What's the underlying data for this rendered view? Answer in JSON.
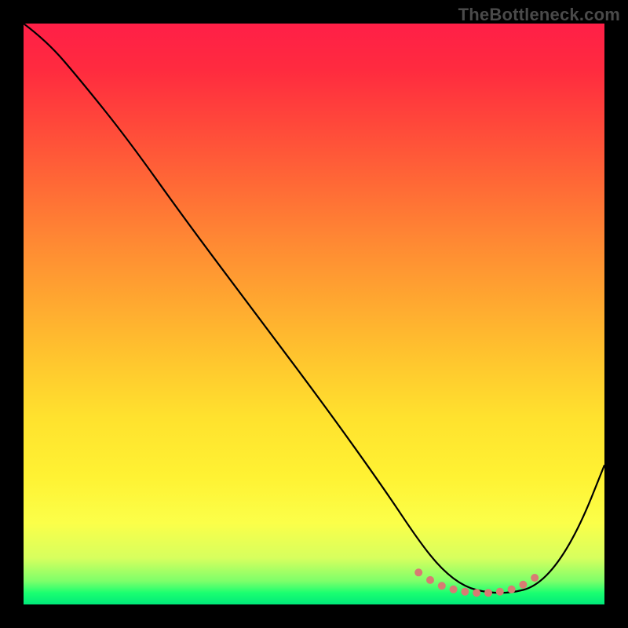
{
  "watermark": "TheBottleneck.com",
  "chart_data": {
    "type": "line",
    "title": "",
    "xlabel": "",
    "ylabel": "",
    "xlim": [
      0,
      100
    ],
    "ylim": [
      0,
      100
    ],
    "grid": false,
    "legend": false,
    "series": [
      {
        "name": "curve",
        "x": [
          0,
          4,
          10,
          18,
          28,
          40,
          52,
          62,
          68,
          72,
          76,
          80,
          84,
          88,
          92,
          96,
          100
        ],
        "y": [
          100,
          97,
          90,
          80,
          66,
          50,
          34,
          20,
          11,
          6,
          3,
          2,
          2,
          3,
          7,
          14,
          24
        ]
      }
    ],
    "markers": {
      "name": "dots",
      "x": [
        68,
        70,
        72,
        74,
        76,
        78,
        80,
        82,
        84,
        86,
        88
      ],
      "y": [
        5.5,
        4.2,
        3.2,
        2.6,
        2.2,
        2.0,
        2.0,
        2.2,
        2.6,
        3.4,
        4.6
      ]
    },
    "background_gradient": {
      "orientation": "vertical",
      "stops": [
        {
          "pos": 0.0,
          "color": "#ff1f47"
        },
        {
          "pos": 0.5,
          "color": "#ffb030"
        },
        {
          "pos": 0.8,
          "color": "#fff233"
        },
        {
          "pos": 0.96,
          "color": "#7dff6a"
        },
        {
          "pos": 1.0,
          "color": "#00e97a"
        }
      ]
    }
  }
}
